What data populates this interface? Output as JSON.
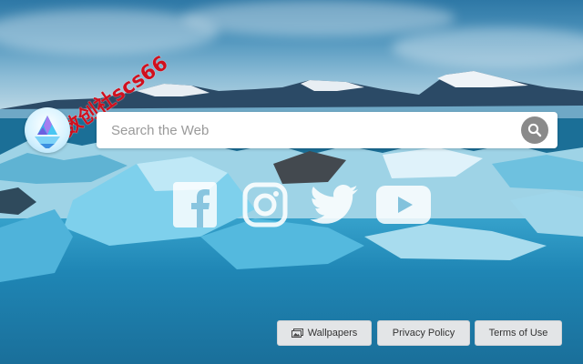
{
  "watermark": {
    "text": "数创社scs66"
  },
  "logo": {
    "icon": "iceberg-logo-icon"
  },
  "search": {
    "placeholder": "Search the Web",
    "value": "",
    "button_icon": "search-icon"
  },
  "social": {
    "links": [
      {
        "name": "facebook",
        "icon": "facebook-icon"
      },
      {
        "name": "instagram",
        "icon": "instagram-icon"
      },
      {
        "name": "twitter",
        "icon": "twitter-icon"
      },
      {
        "name": "youtube",
        "icon": "youtube-icon"
      }
    ]
  },
  "footer": {
    "wallpapers_label": "Wallpapers",
    "wallpapers_icon": "image-icon",
    "privacy_label": "Privacy Policy",
    "terms_label": "Terms of Use"
  },
  "colors": {
    "watermark": "#d0101e",
    "search_button": "#8a8a8a",
    "footer_button_bg": "#e3e5e7"
  }
}
